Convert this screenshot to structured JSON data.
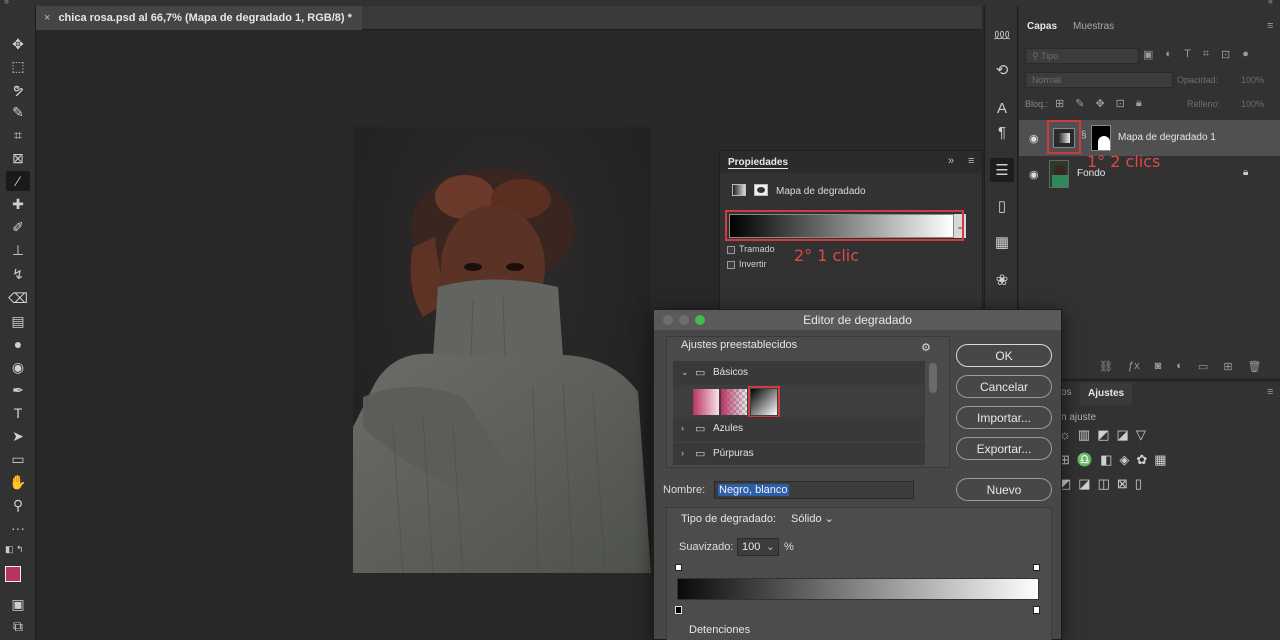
{
  "document": {
    "tab_title": "chica rosa.psd al 66,7% (Mapa de degradado 1, RGB/8) *",
    "close": "×"
  },
  "colors": {
    "foreground": "#b83464",
    "background": "#ffffff",
    "annotation": "#d03a40"
  },
  "toolbar": {
    "tools": [
      "move-icon",
      "marquee-icon",
      "lasso-icon",
      "quick-select-icon",
      "crop-icon",
      "frame-icon",
      "eyedropper-icon",
      "healing-icon",
      "brush-icon",
      "stamp-icon",
      "history-brush-icon",
      "eraser-icon",
      "gradient-icon",
      "blur-icon",
      "dodge-icon",
      "pen-icon",
      "type-icon",
      "path-select-icon",
      "rectangle-icon",
      "hand-icon",
      "zoom-icon",
      "more-icon"
    ]
  },
  "layers_panel": {
    "tabs": [
      "Capas",
      "Muestras"
    ],
    "search_placeholder": "Tipo",
    "blend_mode": "Normal",
    "opacity_label": "Opacidad:",
    "opacity_value": "100%",
    "lock_label": "Bloq.:",
    "fill_label": "Relleno:",
    "fill_value": "100%",
    "layers": [
      {
        "name": "Mapa de degradado 1",
        "selected": true
      },
      {
        "name": "Fondo",
        "selected": false
      }
    ]
  },
  "adjust_panel": {
    "tabs": [
      "os",
      "Ajustes"
    ],
    "add_label": "n ajuste"
  },
  "properties": {
    "title": "Propiedades",
    "subtitle": "Mapa de degradado",
    "tramado": "Tramado",
    "invertir": "Invertir"
  },
  "annotations": {
    "first": "1° 2 clics",
    "second": "2° 1 clic"
  },
  "gradient_editor": {
    "title": "Editor de degradado",
    "presets_label": "Ajustes preestablecidos",
    "folders": [
      "Básicos",
      "Azules",
      "Púrpuras"
    ],
    "buttons": {
      "ok": "OK",
      "cancel": "Cancelar",
      "import": "Importar...",
      "export": "Exportar...",
      "new": "Nuevo"
    },
    "name_label": "Nombre:",
    "name_value": "Negro, blanco",
    "type_label": "Tipo de degradado:",
    "type_value": "Sólido",
    "smooth_label": "Suavizado:",
    "smooth_value": "100",
    "smooth_unit": "%",
    "stops_label": "Detenciones"
  }
}
